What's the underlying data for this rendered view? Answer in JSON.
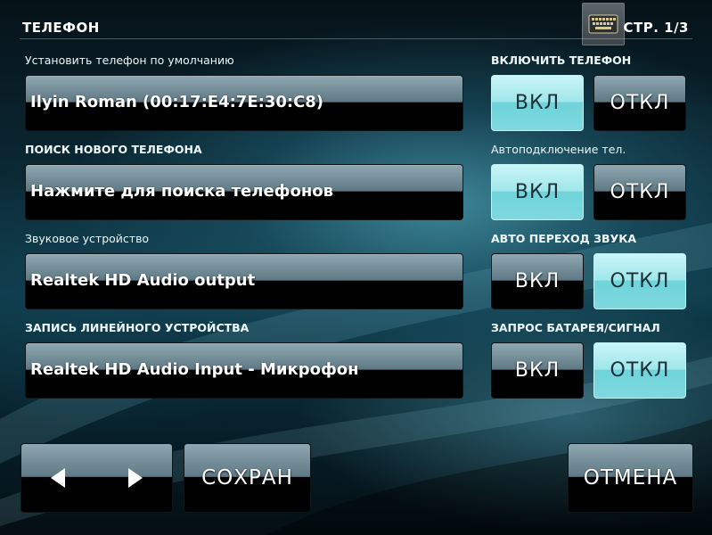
{
  "header": {
    "title": "ТЕЛЕФОН",
    "page": "СТР. 1/3",
    "keyboard_icon": "keyboard-icon"
  },
  "left": {
    "default_phone": {
      "label": "Установить телефон по умолчанию",
      "value": "Ilyin Roman (00:17:E4:7E:30:C8)"
    },
    "search_phone": {
      "label": "ПОИСК НОВОГО ТЕЛЕФОНА",
      "value": "Нажмите для поиска телефонов"
    },
    "audio_device": {
      "label": "Звуковое устройство",
      "value": "Realtek HD Audio output"
    },
    "line_in": {
      "label": "ЗАПИСЬ ЛИНЕЙНОГО УСТРОЙСТВА",
      "value": "Realtek HD Audio Input - Микрофон"
    }
  },
  "right": {
    "enable_phone": {
      "label": "ВКЛЮЧИТЬ ТЕЛЕФОН",
      "on": "ВКЛ",
      "off": "ОТКЛ",
      "selected": "on"
    },
    "autoconnect": {
      "label": "Автоподключение тел.",
      "on": "ВКЛ",
      "off": "ОТКЛ",
      "selected": "on"
    },
    "auto_audio": {
      "label": "АВТО ПЕРЕХОД ЗВУКА",
      "on": "ВКЛ",
      "off": "ОТКЛ",
      "selected": "off"
    },
    "battery_signal": {
      "label": "ЗАПРОС БАТАРЕЯ/СИГНАЛ",
      "on": "ВКЛ",
      "off": "ОТКЛ",
      "selected": "off"
    }
  },
  "footer": {
    "prev_icon": "arrow-left-icon",
    "next_icon": "arrow-right-icon",
    "save": "СОХРАН",
    "cancel": "ОТМЕНА"
  },
  "colors": {
    "active_toggle": "#9fe6ea",
    "inactive_toggle": "#5e7985"
  }
}
